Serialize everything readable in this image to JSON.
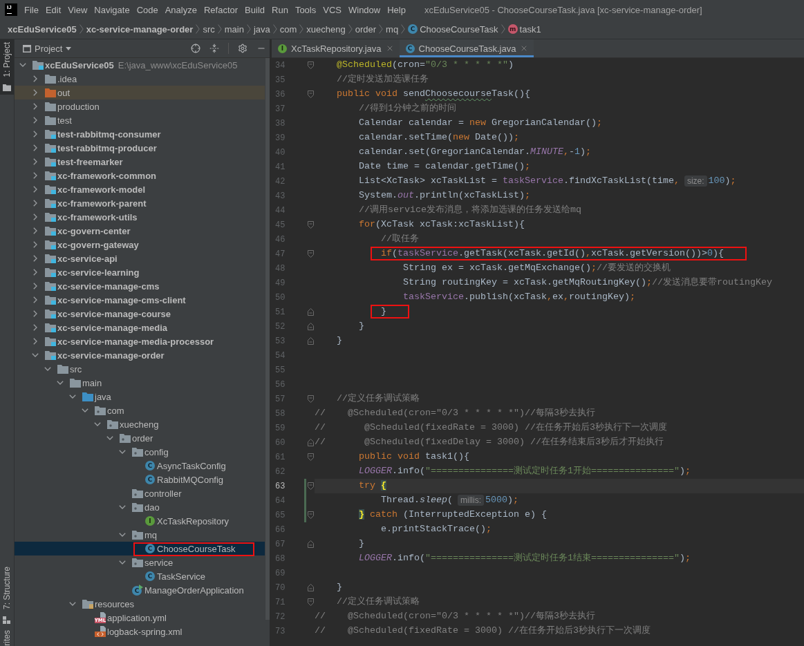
{
  "app_logo": {
    "text": "IJ"
  },
  "menu": [
    "File",
    "Edit",
    "View",
    "Navigate",
    "Code",
    "Analyze",
    "Refactor",
    "Build",
    "Run",
    "Tools",
    "VCS",
    "Window",
    "Help"
  ],
  "window_title": "xcEduService05 - ChooseCourseTask.java [xc-service-manage-order]",
  "breadcrumbs": [
    {
      "label": "xcEduService05",
      "kind": "module"
    },
    {
      "label": "xc-service-manage-order",
      "kind": "module"
    },
    {
      "label": "src",
      "kind": "folder"
    },
    {
      "label": "main",
      "kind": "folder"
    },
    {
      "label": "java",
      "kind": "folder"
    },
    {
      "label": "com",
      "kind": "folder"
    },
    {
      "label": "xuecheng",
      "kind": "folder"
    },
    {
      "label": "order",
      "kind": "folder"
    },
    {
      "label": "mq",
      "kind": "folder"
    },
    {
      "label": "ChooseCourseTask",
      "kind": "class",
      "icon_text": "C"
    },
    {
      "label": "task1",
      "kind": "method",
      "icon_text": "m"
    }
  ],
  "tool_windows": [
    {
      "label": "1: Project",
      "kind": "project",
      "selected": true
    },
    {
      "label": "7: Structure",
      "kind": "structure",
      "selected": false
    },
    {
      "label": "rites",
      "kind": "favorites",
      "selected": false
    }
  ],
  "project_panel": {
    "title": "Project",
    "tree": [
      {
        "label": "xcEduService05",
        "path": "E:\\java_www\\xcEduService05",
        "kind": "module",
        "expanded": true,
        "selected": false,
        "boxed": false,
        "children": [
          {
            "label": ".idea",
            "kind": "folder",
            "expanded": false,
            "selected": false,
            "boxed": false
          },
          {
            "label": "out",
            "kind": "excluded-folder",
            "expanded": false,
            "selected": false,
            "boxed": false
          },
          {
            "label": "production",
            "kind": "folder",
            "expanded": false,
            "selected": false,
            "boxed": false
          },
          {
            "label": "test",
            "kind": "folder",
            "expanded": false,
            "selected": false,
            "boxed": false
          },
          {
            "label": "test-rabbitmq-consumer",
            "kind": "module",
            "expanded": false,
            "selected": false,
            "boxed": false
          },
          {
            "label": "test-rabbitmq-producer",
            "kind": "module",
            "expanded": false,
            "selected": false,
            "boxed": false
          },
          {
            "label": "test-freemarker",
            "kind": "module",
            "expanded": false,
            "selected": false,
            "boxed": false
          },
          {
            "label": "xc-framework-common",
            "kind": "module",
            "expanded": false,
            "selected": false,
            "boxed": false
          },
          {
            "label": "xc-framework-model",
            "kind": "module",
            "expanded": false,
            "selected": false,
            "boxed": false
          },
          {
            "label": "xc-framework-parent",
            "kind": "module",
            "expanded": false,
            "selected": false,
            "boxed": false
          },
          {
            "label": "xc-framework-utils",
            "kind": "module",
            "expanded": false,
            "selected": false,
            "boxed": false
          },
          {
            "label": "xc-govern-center",
            "kind": "module",
            "expanded": false,
            "selected": false,
            "boxed": false
          },
          {
            "label": "xc-govern-gateway",
            "kind": "module",
            "expanded": false,
            "selected": false,
            "boxed": false
          },
          {
            "label": "xc-service-api",
            "kind": "module",
            "expanded": false,
            "selected": false,
            "boxed": false
          },
          {
            "label": "xc-service-learning",
            "kind": "module",
            "expanded": false,
            "selected": false,
            "boxed": false
          },
          {
            "label": "xc-service-manage-cms",
            "kind": "module",
            "expanded": false,
            "selected": false,
            "boxed": false
          },
          {
            "label": "xc-service-manage-cms-client",
            "kind": "module",
            "expanded": false,
            "selected": false,
            "boxed": false
          },
          {
            "label": "xc-service-manage-course",
            "kind": "module",
            "expanded": false,
            "selected": false,
            "boxed": false
          },
          {
            "label": "xc-service-manage-media",
            "kind": "module",
            "expanded": false,
            "selected": false,
            "boxed": false
          },
          {
            "label": "xc-service-manage-media-processor",
            "kind": "module",
            "expanded": false,
            "selected": false,
            "boxed": false
          },
          {
            "label": "xc-service-manage-order",
            "kind": "module",
            "expanded": true,
            "selected": false,
            "boxed": false,
            "children": [
              {
                "label": "src",
                "kind": "folder",
                "expanded": true,
                "selected": false,
                "boxed": false,
                "children": [
                  {
                    "label": "main",
                    "kind": "folder",
                    "expanded": true,
                    "selected": false,
                    "boxed": false,
                    "children": [
                      {
                        "label": "java",
                        "kind": "source-folder",
                        "expanded": true,
                        "selected": false,
                        "boxed": false,
                        "children": [
                          {
                            "label": "com",
                            "kind": "package",
                            "expanded": true,
                            "selected": false,
                            "boxed": false,
                            "children": [
                              {
                                "label": "xuecheng",
                                "kind": "package",
                                "expanded": true,
                                "selected": false,
                                "boxed": false,
                                "children": [
                                  {
                                    "label": "order",
                                    "kind": "package",
                                    "expanded": true,
                                    "selected": false,
                                    "boxed": false,
                                    "children": [
                                      {
                                        "label": "config",
                                        "kind": "package",
                                        "expanded": true,
                                        "selected": false,
                                        "boxed": false,
                                        "children": [
                                          {
                                            "label": "AsyncTaskConfig",
                                            "kind": "class",
                                            "icon_text": "C",
                                            "selected": false,
                                            "boxed": false
                                          },
                                          {
                                            "label": "RabbitMQConfig",
                                            "kind": "class",
                                            "icon_text": "C",
                                            "selected": false,
                                            "boxed": false
                                          }
                                        ]
                                      },
                                      {
                                        "label": "controller",
                                        "kind": "package",
                                        "selected": false,
                                        "boxed": false
                                      },
                                      {
                                        "label": "dao",
                                        "kind": "package",
                                        "expanded": true,
                                        "selected": false,
                                        "boxed": false,
                                        "children": [
                                          {
                                            "label": "XcTaskRepository",
                                            "kind": "interface",
                                            "icon_text": "I",
                                            "selected": false,
                                            "boxed": false
                                          }
                                        ]
                                      },
                                      {
                                        "label": "mq",
                                        "kind": "package",
                                        "expanded": true,
                                        "selected": false,
                                        "boxed": false,
                                        "children": [
                                          {
                                            "label": "ChooseCourseTask",
                                            "kind": "class",
                                            "icon_text": "C",
                                            "selected": true,
                                            "boxed": true
                                          }
                                        ]
                                      },
                                      {
                                        "label": "service",
                                        "kind": "package",
                                        "expanded": true,
                                        "selected": false,
                                        "boxed": false,
                                        "children": [
                                          {
                                            "label": "TaskService",
                                            "kind": "class",
                                            "icon_text": "C",
                                            "selected": false,
                                            "boxed": false
                                          }
                                        ]
                                      },
                                      {
                                        "label": "ManageOrderApplication",
                                        "kind": "app-class",
                                        "icon_text": "C",
                                        "selected": false,
                                        "boxed": false
                                      }
                                    ]
                                  }
                                ]
                              }
                            ]
                          }
                        ]
                      },
                      {
                        "label": "resources",
                        "kind": "resources-folder",
                        "expanded": true,
                        "selected": false,
                        "boxed": false,
                        "children": [
                          {
                            "label": "application.yml",
                            "kind": "yml-file",
                            "icon_text": "YML",
                            "selected": false,
                            "boxed": false
                          },
                          {
                            "label": "logback-spring.xml",
                            "kind": "xml-file",
                            "selected": false,
                            "boxed": false
                          }
                        ]
                      }
                    ]
                  }
                ]
              }
            ]
          }
        ]
      }
    ]
  },
  "editor": {
    "tabs": [
      {
        "label": "XcTaskRepository.java",
        "kind": "interface",
        "icon_text": "I",
        "selected": false
      },
      {
        "label": "ChooseCourseTask.java",
        "kind": "class",
        "icon_text": "C",
        "selected": true
      }
    ],
    "lines": [
      {
        "number": "34",
        "kind": "block-start",
        "current": false,
        "modified": false,
        "boxed": false,
        "tokens": [
          {
            "kind": "annotation",
            "text": "    @Scheduled"
          },
          {
            "kind": "plain",
            "text": "(cron="
          },
          {
            "kind": "string",
            "text": "\"0/3 * * * * *\""
          },
          {
            "kind": "plain",
            "text": ")"
          }
        ]
      },
      {
        "number": "35",
        "kind": "line",
        "current": false,
        "modified": false,
        "boxed": false,
        "tokens": [
          {
            "kind": "comment",
            "text": "    //定时发送加选课任务"
          }
        ]
      },
      {
        "number": "36",
        "kind": "block-start",
        "current": false,
        "modified": false,
        "boxed": false,
        "tokens": [
          {
            "kind": "keyword",
            "text": "    public void "
          },
          {
            "kind": "plain",
            "text": "send"
          },
          {
            "kind": "typo",
            "text": "Choosecourse"
          },
          {
            "kind": "plain",
            "text": "Task(){"
          }
        ]
      },
      {
        "number": "37",
        "kind": "line",
        "current": false,
        "modified": false,
        "boxed": false,
        "tokens": [
          {
            "kind": "comment",
            "text": "        //得到1分钟之前的时间"
          }
        ]
      },
      {
        "number": "38",
        "kind": "line",
        "current": false,
        "modified": false,
        "boxed": false,
        "tokens": [
          {
            "kind": "plain",
            "text": "        Calendar calendar = "
          },
          {
            "kind": "keyword",
            "text": "new "
          },
          {
            "kind": "plain",
            "text": "GregorianCalendar()"
          },
          {
            "kind": "keyword",
            "text": ";"
          }
        ]
      },
      {
        "number": "39",
        "kind": "line",
        "current": false,
        "modified": false,
        "boxed": false,
        "tokens": [
          {
            "kind": "plain",
            "text": "        calendar.setTime("
          },
          {
            "kind": "keyword",
            "text": "new "
          },
          {
            "kind": "plain",
            "text": "Date())"
          },
          {
            "kind": "keyword",
            "text": ";"
          }
        ]
      },
      {
        "number": "40",
        "kind": "line",
        "current": false,
        "modified": false,
        "boxed": false,
        "tokens": [
          {
            "kind": "plain",
            "text": "        calendar.set(GregorianCalendar."
          },
          {
            "kind": "static-field",
            "text": "MINUTE"
          },
          {
            "kind": "keyword",
            "text": ","
          },
          {
            "kind": "plain",
            "text": "-"
          },
          {
            "kind": "number",
            "text": "1"
          },
          {
            "kind": "plain",
            "text": ")"
          },
          {
            "kind": "keyword",
            "text": ";"
          }
        ]
      },
      {
        "number": "41",
        "kind": "line",
        "current": false,
        "modified": false,
        "boxed": false,
        "tokens": [
          {
            "kind": "plain",
            "text": "        Date time = calendar.getTime()"
          },
          {
            "kind": "keyword",
            "text": ";"
          }
        ]
      },
      {
        "number": "42",
        "kind": "line",
        "current": false,
        "modified": false,
        "boxed": false,
        "tokens": [
          {
            "kind": "plain",
            "text": "        List<XcTask> xcTaskList = "
          },
          {
            "kind": "field",
            "text": "taskService"
          },
          {
            "kind": "plain",
            "text": ".findXcTaskList(time"
          },
          {
            "kind": "keyword",
            "text": ","
          },
          {
            "kind": "hint",
            "text": "size:"
          },
          {
            "kind": "number",
            "text": "100"
          },
          {
            "kind": "plain",
            "text": ")"
          },
          {
            "kind": "keyword",
            "text": ";"
          }
        ]
      },
      {
        "number": "43",
        "kind": "line",
        "current": false,
        "modified": false,
        "boxed": false,
        "tokens": [
          {
            "kind": "plain",
            "text": "        System."
          },
          {
            "kind": "static-field",
            "text": "out"
          },
          {
            "kind": "plain",
            "text": ".println(xcTaskList)"
          },
          {
            "kind": "keyword",
            "text": ";"
          }
        ]
      },
      {
        "number": "44",
        "kind": "line",
        "current": false,
        "modified": false,
        "boxed": false,
        "tokens": [
          {
            "kind": "comment",
            "text": "        //调用service发布消息，将添加选课的任务发送给mq"
          }
        ]
      },
      {
        "number": "45",
        "kind": "block-start",
        "current": false,
        "modified": false,
        "boxed": false,
        "tokens": [
          {
            "kind": "keyword",
            "text": "        for"
          },
          {
            "kind": "plain",
            "text": "(XcTask xcTask:xcTaskList){"
          }
        ]
      },
      {
        "number": "46",
        "kind": "line",
        "current": false,
        "modified": false,
        "boxed": false,
        "tokens": [
          {
            "kind": "comment",
            "text": "            //取任务"
          }
        ]
      },
      {
        "number": "47",
        "kind": "block-start",
        "current": false,
        "modified": false,
        "boxed": true,
        "tokens": [
          {
            "kind": "keyword",
            "text": "            if"
          },
          {
            "kind": "plain",
            "text": "("
          },
          {
            "kind": "field",
            "text": "taskService"
          },
          {
            "kind": "plain",
            "text": ".getTask(xcTask.getId()"
          },
          {
            "kind": "keyword",
            "text": ","
          },
          {
            "kind": "plain",
            "text": "xcTask.getVersion())>"
          },
          {
            "kind": "number",
            "text": "0"
          },
          {
            "kind": "plain",
            "text": "){"
          }
        ]
      },
      {
        "number": "48",
        "kind": "line",
        "current": false,
        "modified": false,
        "boxed": false,
        "tokens": [
          {
            "kind": "plain",
            "text": "                String ex = xcTask.getMqExchange()"
          },
          {
            "kind": "keyword",
            "text": ";"
          },
          {
            "kind": "comment",
            "text": "//要发送的交换机"
          }
        ]
      },
      {
        "number": "49",
        "kind": "line",
        "current": false,
        "modified": false,
        "boxed": false,
        "tokens": [
          {
            "kind": "plain",
            "text": "                String routingKey = xcTask.getMqRoutingKey()"
          },
          {
            "kind": "keyword",
            "text": ";"
          },
          {
            "kind": "comment",
            "text": "//发送消息要带routingKey"
          }
        ]
      },
      {
        "number": "50",
        "kind": "line",
        "current": false,
        "modified": false,
        "boxed": false,
        "tokens": [
          {
            "kind": "field",
            "text": "                taskService"
          },
          {
            "kind": "plain",
            "text": ".publish(xcTask"
          },
          {
            "kind": "keyword",
            "text": ","
          },
          {
            "kind": "plain",
            "text": "ex"
          },
          {
            "kind": "keyword",
            "text": ","
          },
          {
            "kind": "plain",
            "text": "routingKey)"
          },
          {
            "kind": "keyword",
            "text": ";"
          }
        ]
      },
      {
        "number": "51",
        "kind": "block-end",
        "current": false,
        "modified": false,
        "boxed": true,
        "tokens": [
          {
            "kind": "plain",
            "text": "            }"
          }
        ]
      },
      {
        "number": "52",
        "kind": "block-end",
        "current": false,
        "modified": false,
        "boxed": false,
        "tokens": [
          {
            "kind": "plain",
            "text": "        }"
          }
        ]
      },
      {
        "number": "53",
        "kind": "block-end",
        "current": false,
        "modified": false,
        "boxed": false,
        "tokens": [
          {
            "kind": "plain",
            "text": "    }"
          }
        ]
      },
      {
        "number": "54",
        "kind": "line",
        "current": false,
        "modified": false,
        "boxed": false
      },
      {
        "number": "55",
        "kind": "line",
        "current": false,
        "modified": false,
        "boxed": false
      },
      {
        "number": "56",
        "kind": "line",
        "current": false,
        "modified": false,
        "boxed": false
      },
      {
        "number": "57",
        "kind": "block-start",
        "current": false,
        "modified": false,
        "boxed": false,
        "tokens": [
          {
            "kind": "comment",
            "text": "    //定义任务调试策略"
          }
        ]
      },
      {
        "number": "58",
        "kind": "line",
        "current": false,
        "modified": false,
        "boxed": false,
        "tokens": [
          {
            "kind": "comment",
            "text": "//    @Scheduled(cron=\"0/3 * * * * *\")//每隔3秒去执行"
          }
        ]
      },
      {
        "number": "59",
        "kind": "line",
        "current": false,
        "modified": false,
        "boxed": false,
        "tokens": [
          {
            "kind": "comment",
            "text": "//       @Scheduled(fixedRate = 3000) //在任务开始后3秒执行下一次调度"
          }
        ]
      },
      {
        "number": "60",
        "kind": "block-end",
        "current": false,
        "modified": false,
        "boxed": false,
        "tokens": [
          {
            "kind": "comment",
            "text": "//       @Scheduled(fixedDelay = 3000) //在任务结束后3秒后才开始执行"
          }
        ]
      },
      {
        "number": "61",
        "kind": "block-start",
        "current": false,
        "modified": false,
        "boxed": false,
        "tokens": [
          {
            "kind": "keyword",
            "text": "        public void "
          },
          {
            "kind": "plain",
            "text": "task1(){"
          }
        ]
      },
      {
        "number": "62",
        "kind": "line",
        "current": false,
        "modified": false,
        "boxed": false,
        "tokens": [
          {
            "kind": "static-field",
            "text": "        LOGGER"
          },
          {
            "kind": "plain",
            "text": ".info("
          },
          {
            "kind": "string",
            "text": "\"===============测试定时任务1开始===============\""
          },
          {
            "kind": "plain",
            "text": ")"
          },
          {
            "kind": "keyword",
            "text": ";"
          }
        ]
      },
      {
        "number": "63",
        "kind": "block-start",
        "current": true,
        "modified": true,
        "boxed": false,
        "tokens": [
          {
            "kind": "keyword",
            "text": "        try "
          },
          {
            "kind": "matched-brace",
            "text": "{"
          }
        ]
      },
      {
        "number": "64",
        "kind": "line",
        "current": false,
        "modified": true,
        "boxed": false,
        "tokens": [
          {
            "kind": "plain",
            "text": "            Thread."
          },
          {
            "kind": "static-method",
            "text": "sleep"
          },
          {
            "kind": "plain",
            "text": "("
          },
          {
            "kind": "hint",
            "text": "millis:"
          },
          {
            "kind": "number",
            "text": "5000"
          },
          {
            "kind": "plain",
            "text": ")"
          },
          {
            "kind": "keyword",
            "text": ";"
          }
        ]
      },
      {
        "number": "65",
        "kind": "block-start",
        "current": false,
        "modified": true,
        "boxed": false,
        "tokens": [
          {
            "kind": "matched-brace",
            "text": "        }"
          },
          {
            "kind": "keyword",
            "text": " catch "
          },
          {
            "kind": "plain",
            "text": "(InterruptedException e) {"
          }
        ]
      },
      {
        "number": "66",
        "kind": "line",
        "current": false,
        "modified": false,
        "boxed": false,
        "tokens": [
          {
            "kind": "plain",
            "text": "            e.printStackTrace()"
          },
          {
            "kind": "keyword",
            "text": ";"
          }
        ]
      },
      {
        "number": "67",
        "kind": "block-end",
        "current": false,
        "modified": false,
        "boxed": false,
        "tokens": [
          {
            "kind": "plain",
            "text": "        }"
          }
        ]
      },
      {
        "number": "68",
        "kind": "line",
        "current": false,
        "modified": false,
        "boxed": false,
        "tokens": [
          {
            "kind": "static-field",
            "text": "        LOGGER"
          },
          {
            "kind": "plain",
            "text": ".info("
          },
          {
            "kind": "string",
            "text": "\"===============测试定时任务1结束===============\""
          },
          {
            "kind": "plain",
            "text": ")"
          },
          {
            "kind": "keyword",
            "text": ";"
          }
        ]
      },
      {
        "number": "69",
        "kind": "line",
        "current": false,
        "modified": false,
        "boxed": false
      },
      {
        "number": "70",
        "kind": "block-end",
        "current": false,
        "modified": false,
        "boxed": false,
        "tokens": [
          {
            "kind": "plain",
            "text": "    }"
          }
        ]
      },
      {
        "number": "71",
        "kind": "block-start",
        "current": false,
        "modified": false,
        "boxed": false,
        "tokens": [
          {
            "kind": "comment",
            "text": "    //定义任务调试策略"
          }
        ]
      },
      {
        "number": "72",
        "kind": "line",
        "current": false,
        "modified": false,
        "boxed": false,
        "tokens": [
          {
            "kind": "comment",
            "text": "//    @Scheduled(cron=\"0/3 * * * * *\")//每隔3秒去执行"
          }
        ]
      },
      {
        "number": "73",
        "kind": "line",
        "current": false,
        "modified": false,
        "boxed": false,
        "tokens": [
          {
            "kind": "comment",
            "text": "//    @Scheduled(fixedRate = 3000) //在任务开始后3秒执行下一次调度"
          }
        ]
      }
    ]
  }
}
